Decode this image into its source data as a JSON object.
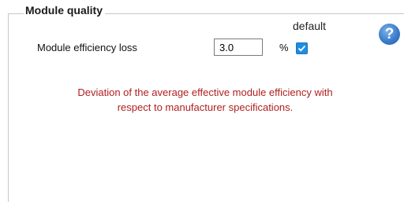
{
  "group": {
    "title": "Module quality"
  },
  "efficiency": {
    "label": "Module efficiency loss",
    "value": "3.0",
    "unit": "%",
    "default_label": "default",
    "default_checked": true
  },
  "help": {
    "glyph": "?",
    "icon": "help-icon"
  },
  "description": {
    "line1": "Deviation of the average effective module efficiency with",
    "line2": "respect to manufacturer specifications."
  },
  "colors": {
    "description_text": "#b02020",
    "checkbox_accent": "#1e8ee0",
    "help_icon": "#3a7ccb"
  }
}
